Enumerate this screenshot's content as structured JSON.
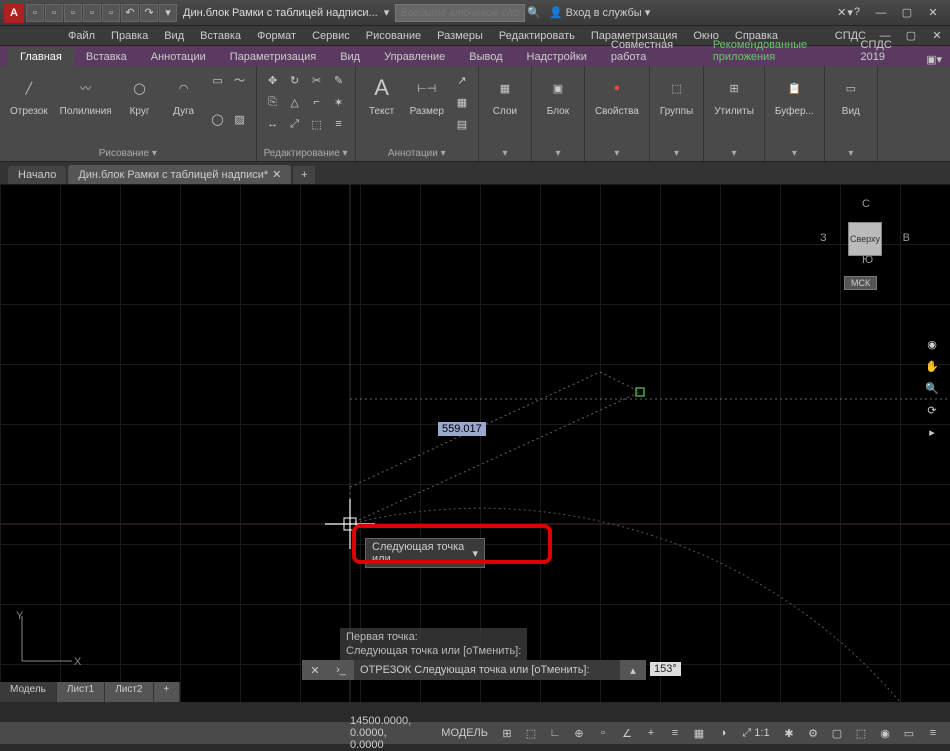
{
  "titlebar": {
    "doc_title": "Дин.блок Рамки с таблицей надписи...",
    "search_placeholder": "Введите ключевое слово/фразу",
    "signin": "Вход в службы"
  },
  "menu": [
    "Файл",
    "Правка",
    "Вид",
    "Вставка",
    "Формат",
    "Сервис",
    "Рисование",
    "Размеры",
    "Редактировать",
    "Параметризация",
    "Окно",
    "Справка"
  ],
  "ribbon_tabs": [
    "Главная",
    "Вставка",
    "Аннотации",
    "Параметризация",
    "Вид",
    "Управление",
    "Вывод",
    "Надстройки",
    "Совместная работа",
    "Рекомендованные приложения",
    "СПДС 2019"
  ],
  "ribbon_active": 0,
  "panels": {
    "draw": {
      "title": "Рисование ▾",
      "tools": [
        "Отрезок",
        "Полилиния",
        "Круг",
        "Дуга"
      ]
    },
    "edit": {
      "title": "Редактирование ▾"
    },
    "annot": {
      "title": "Аннотации ▾",
      "tools": [
        "Текст",
        "Размер"
      ]
    },
    "layers": {
      "title": "Слои"
    },
    "block": {
      "title": "Блок"
    },
    "props": {
      "title": "Свойства"
    },
    "groups": {
      "title": "Группы"
    },
    "util": {
      "title": "Утилиты"
    },
    "clip": {
      "title": "Буфер..."
    },
    "view": {
      "title": "Вид"
    }
  },
  "doc_tabs": {
    "start": "Начало",
    "file": "Дин.блок Рамки с таблицей надписи*"
  },
  "viewport": {
    "dyn_value": "559.017",
    "tooltip": "Следующая точка или",
    "cmd_history": [
      "Первая точка:",
      "Следующая точка или [оТменить]:"
    ],
    "cmd_prompt": "ОТРЕЗОК Следующая точка или [оТменить]:",
    "angle": "153°"
  },
  "viewcube": {
    "face": "Сверху",
    "n": "С",
    "s": "Ю",
    "e": "В",
    "w": "З",
    "wcs": "МСК"
  },
  "layout_tabs": [
    "Модель",
    "Лист1",
    "Лист2"
  ],
  "status": {
    "coords": "14500.0000, 0.0000, 0.0000",
    "model": "МОДЕЛЬ"
  }
}
